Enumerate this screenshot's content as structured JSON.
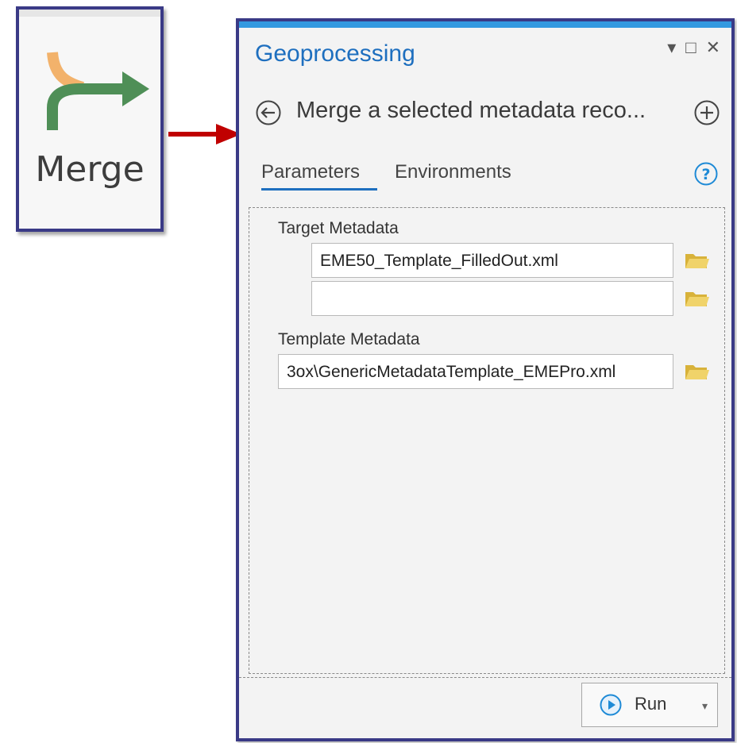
{
  "merge_tool": {
    "label": "Merge",
    "icon": "merge-icon"
  },
  "pane": {
    "title": "Geoprocessing",
    "controls": [
      "dropdown-icon",
      "maximize-icon",
      "close-icon"
    ],
    "tool_title": "Merge a selected metadata reco...",
    "tabs": [
      {
        "label": "Parameters",
        "active": true
      },
      {
        "label": "Environments",
        "active": false
      }
    ],
    "params": {
      "target_label": "Target Metadata",
      "target_values": [
        "EME50_Template_FilledOut.xml",
        ""
      ],
      "template_label": "Template Metadata",
      "template_value": "3ox\\GenericMetadataTemplate_EMEPro.xml"
    },
    "run_label": "Run"
  },
  "colors": {
    "accent": "#3399e0",
    "title_blue": "#1e6fbf",
    "frame": "#3a3a86",
    "arrow": "#c00000",
    "folder": "#e8c84a"
  }
}
